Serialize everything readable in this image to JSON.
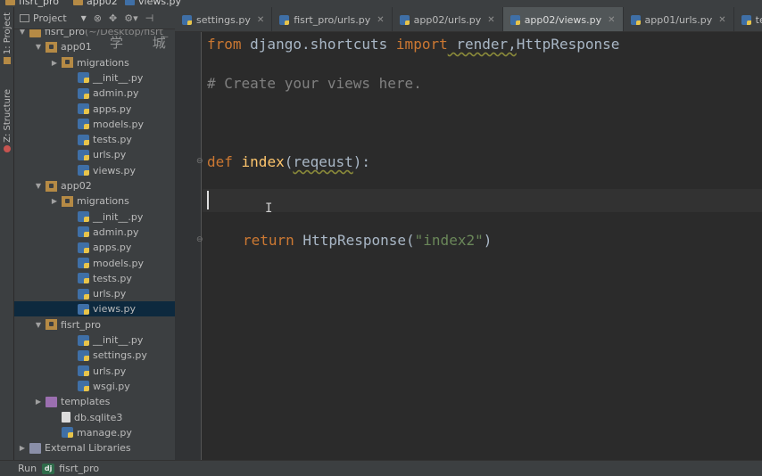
{
  "breadcrumbs": [
    "fisrt_pro",
    "app02",
    "views.py"
  ],
  "tool_strip": {
    "project_tab": "1: Project",
    "structure_tab": "Z: Structure"
  },
  "project_panel": {
    "view_label": "Project",
    "watermark": "学 城"
  },
  "tree": [
    {
      "label": "fisrt_pro",
      "suffix": " (~/Desktop/fisrt_",
      "kind": "folder",
      "depth": 0,
      "expanded": true
    },
    {
      "label": "app01",
      "kind": "pkg",
      "depth": 1,
      "expanded": true
    },
    {
      "label": "migrations",
      "kind": "pkg",
      "depth": 2,
      "expanded": false
    },
    {
      "label": "__init__.py",
      "kind": "py",
      "depth": 3
    },
    {
      "label": "admin.py",
      "kind": "py",
      "depth": 3
    },
    {
      "label": "apps.py",
      "kind": "py",
      "depth": 3
    },
    {
      "label": "models.py",
      "kind": "py",
      "depth": 3
    },
    {
      "label": "tests.py",
      "kind": "py",
      "depth": 3
    },
    {
      "label": "urls.py",
      "kind": "py",
      "depth": 3
    },
    {
      "label": "views.py",
      "kind": "py",
      "depth": 3
    },
    {
      "label": "app02",
      "kind": "pkg",
      "depth": 1,
      "expanded": true
    },
    {
      "label": "migrations",
      "kind": "pkg",
      "depth": 2,
      "expanded": false
    },
    {
      "label": "__init__.py",
      "kind": "py",
      "depth": 3
    },
    {
      "label": "admin.py",
      "kind": "py",
      "depth": 3
    },
    {
      "label": "apps.py",
      "kind": "py",
      "depth": 3
    },
    {
      "label": "models.py",
      "kind": "py",
      "depth": 3
    },
    {
      "label": "tests.py",
      "kind": "py",
      "depth": 3
    },
    {
      "label": "urls.py",
      "kind": "py",
      "depth": 3
    },
    {
      "label": "views.py",
      "kind": "py",
      "depth": 3,
      "selected": true
    },
    {
      "label": "fisrt_pro",
      "kind": "pkg",
      "depth": 1,
      "expanded": true
    },
    {
      "label": "__init__.py",
      "kind": "py",
      "depth": 3
    },
    {
      "label": "settings.py",
      "kind": "py",
      "depth": 3
    },
    {
      "label": "urls.py",
      "kind": "py",
      "depth": 3
    },
    {
      "label": "wsgi.py",
      "kind": "py",
      "depth": 3
    },
    {
      "label": "templates",
      "kind": "tpl",
      "depth": 1,
      "expanded": false
    },
    {
      "label": "db.sqlite3",
      "kind": "db",
      "depth": 2
    },
    {
      "label": "manage.py",
      "kind": "py",
      "depth": 2
    },
    {
      "label": "External Libraries",
      "kind": "lib",
      "depth": 0,
      "expanded": false
    }
  ],
  "tabs": [
    {
      "label": "settings.py",
      "active": false
    },
    {
      "label": "fisrt_pro/urls.py",
      "active": false
    },
    {
      "label": "app02/urls.py",
      "active": false
    },
    {
      "label": "app02/views.py",
      "active": true
    },
    {
      "label": "app01/urls.py",
      "active": false
    },
    {
      "label": "tests.py",
      "active": false
    }
  ],
  "code": {
    "l1_from": "from",
    "l1_mod": " django.shortcuts ",
    "l1_import": "import",
    "l1_render": " render,",
    "l1_cls": "HttpResponse",
    "l3_comment": "# Create your views here.",
    "l6_def": "def",
    "l6_name": " index",
    "l6_open": "(",
    "l6_param": "reqeust",
    "l6_close": "):",
    "l10_return": "return",
    "l10_call": " HttpResponse(",
    "l10_str": "\"index2\"",
    "l10_close": ")"
  },
  "status": {
    "run_label": "Run",
    "dj_badge": "dj",
    "run_config": "fisrt_pro"
  },
  "colors": {
    "keyword": "#cc7832",
    "comment": "#808080",
    "function": "#ffc66d",
    "string": "#6a8759",
    "selection": "#0d293e"
  }
}
